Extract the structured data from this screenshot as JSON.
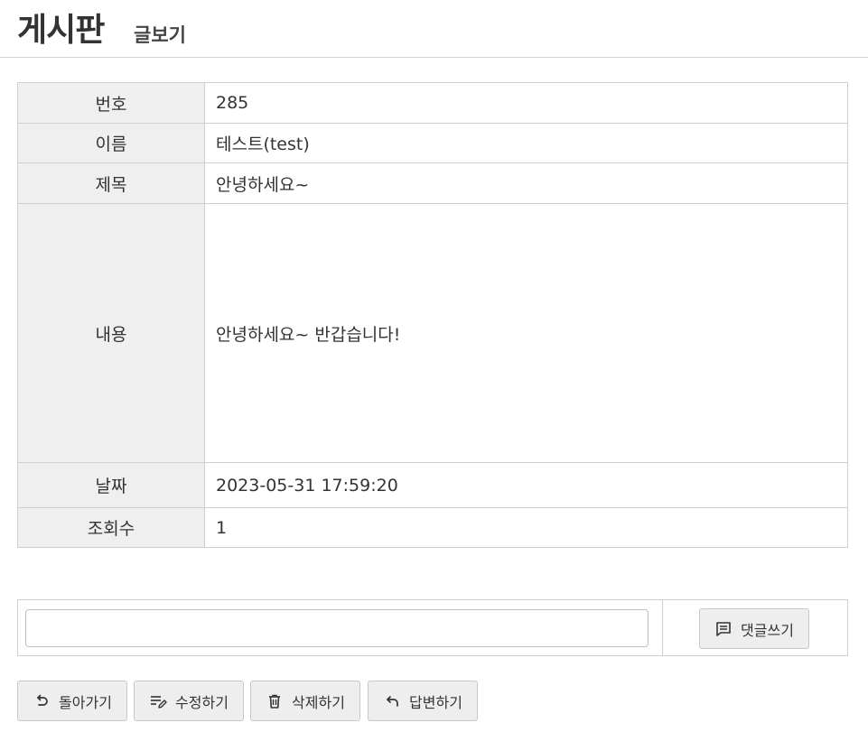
{
  "header": {
    "title": "게시판",
    "subtitle": "글보기"
  },
  "post": {
    "rows": [
      {
        "label": "번호",
        "value": "285"
      },
      {
        "label": "이름",
        "value": "테스트(test)"
      },
      {
        "label": "제목",
        "value": "안녕하세요~"
      },
      {
        "label": "내용",
        "value": "안녕하세요~ 반갑습니다!"
      },
      {
        "label": "날짜",
        "value": "2023-05-31 17:59:20"
      },
      {
        "label": "조회수",
        "value": "1"
      }
    ]
  },
  "comment": {
    "input_value": "",
    "submit_label": "댓글쓰기",
    "submit_icon": "comment-icon"
  },
  "actions": {
    "back_label": "돌아가기",
    "back_icon": "undo-icon",
    "edit_label": "수정하기",
    "edit_icon": "edit-list-icon",
    "delete_label": "삭제하기",
    "delete_icon": "trash-icon",
    "reply_label": "답변하기",
    "reply_icon": "reply-icon"
  }
}
